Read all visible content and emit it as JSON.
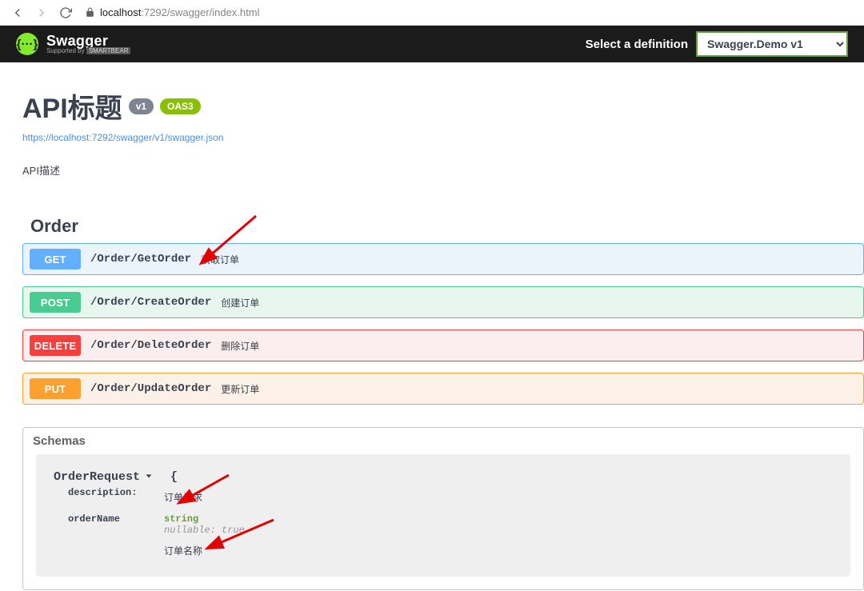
{
  "browser": {
    "url_host": "localhost",
    "url_port_path": ":7292/swagger/index.html"
  },
  "topbar": {
    "brand": "Swagger",
    "supported": "Supported by",
    "smartbear": "SMARTBEAR",
    "select_label": "Select a definition",
    "definition_selected": "Swagger.Demo v1"
  },
  "info": {
    "title": "API标题",
    "version_badge": "v1",
    "oas_badge": "OAS3",
    "spec_link": "https://localhost:7292/swagger/v1/swagger.json",
    "description": "API描述"
  },
  "tag": {
    "name": "Order"
  },
  "ops": [
    {
      "method": "GET",
      "cls": "get",
      "path": "/Order/GetOrder",
      "desc": "获取订单"
    },
    {
      "method": "POST",
      "cls": "post",
      "path": "/Order/CreateOrder",
      "desc": "创建订单"
    },
    {
      "method": "DELETE",
      "cls": "delete",
      "path": "/Order/DeleteOrder",
      "desc": "删除订单"
    },
    {
      "method": "PUT",
      "cls": "put",
      "path": "/Order/UpdateOrder",
      "desc": "更新订单"
    }
  ],
  "schemas": {
    "header": "Schemas",
    "model_name": "OrderRequest",
    "brace_open": "{",
    "desc_label": "description:",
    "desc_value": "订单请求",
    "prop_name": "orderName",
    "prop_type": "string",
    "nullable_label": "nullable:",
    "nullable_value": "true",
    "prop_desc": "订单名称"
  }
}
